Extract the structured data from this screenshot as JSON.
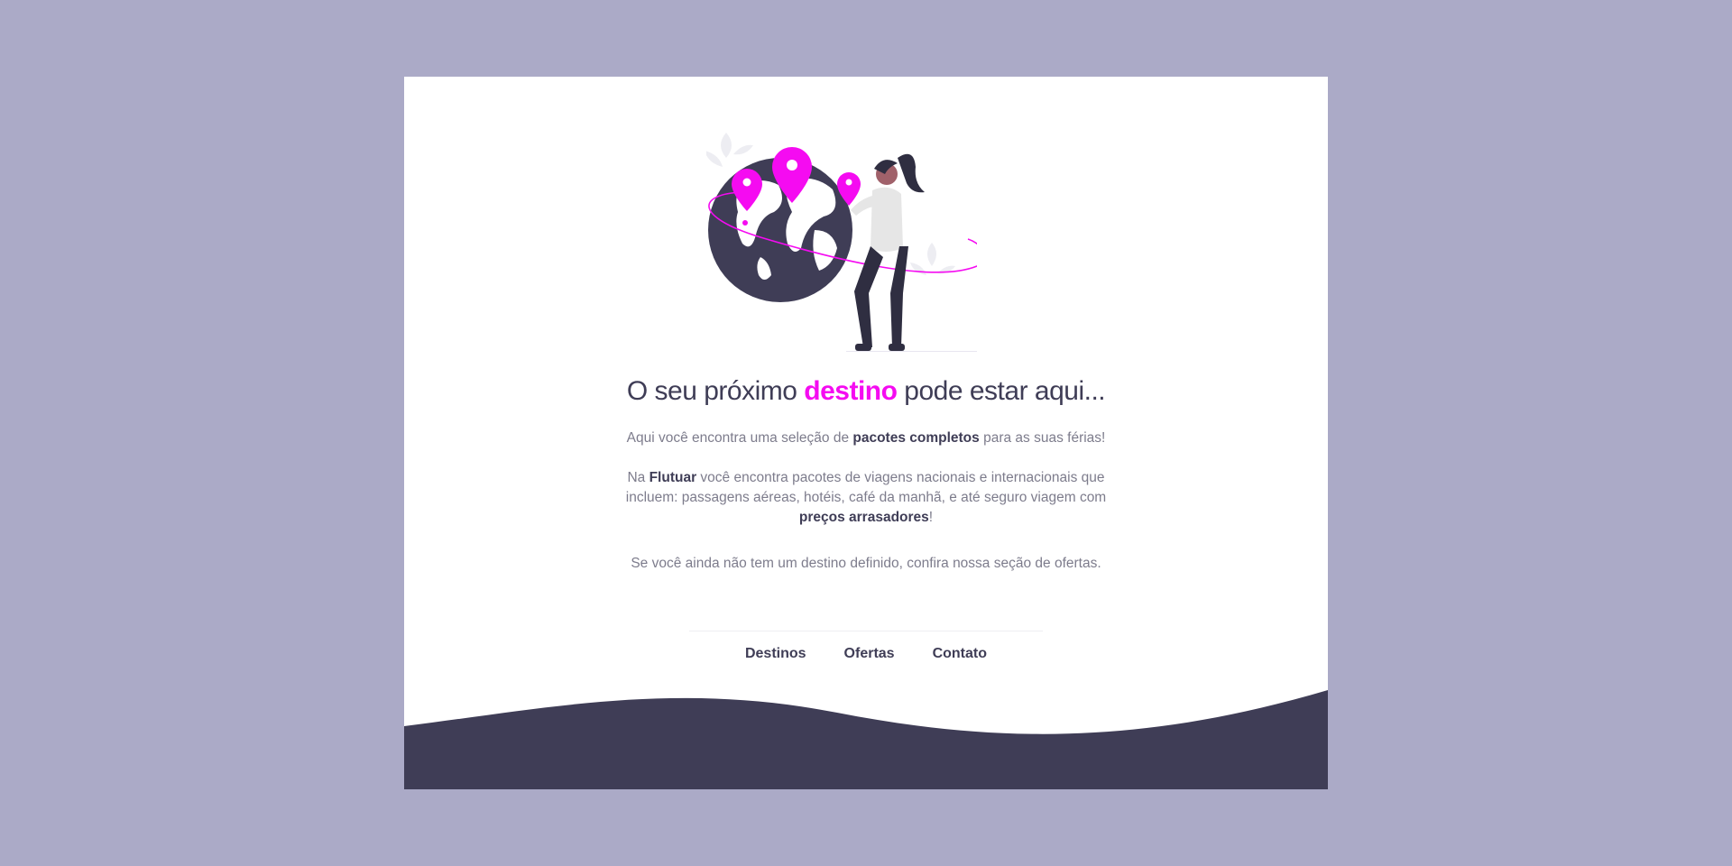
{
  "hero": {
    "title_before": "O seu próximo ",
    "title_accent": "destino",
    "title_after": " pode estar aqui...",
    "p1_before": "Aqui você encontra uma seleção de ",
    "p1_bold": "pacotes completos",
    "p1_after": " para as suas férias!",
    "p2_before": "Na ",
    "p2_brand": "Flutuar",
    "p2_middle": " você encontra pacotes de viagens nacionais e internacionais que incluem: passagens aéreas, hotéis, café da manhã, e até seguro viagem com ",
    "p2_bold": "preços arrasadores",
    "p2_after": "!",
    "p3": "Se você ainda não tem um destino definido, confira nossa seção de ofertas."
  },
  "nav": {
    "items": [
      "Destinos",
      "Ofertas",
      "Contato"
    ]
  },
  "colors": {
    "background": "#ABAAC7",
    "card": "#FFFFFF",
    "accent": "#F50BF1",
    "dark": "#3F3D56",
    "muted_text": "#7D7C8C"
  },
  "illustration": {
    "icons": [
      "globe-icon",
      "map-pin-icon",
      "woman-traveler-icon",
      "leaf-icon"
    ]
  }
}
